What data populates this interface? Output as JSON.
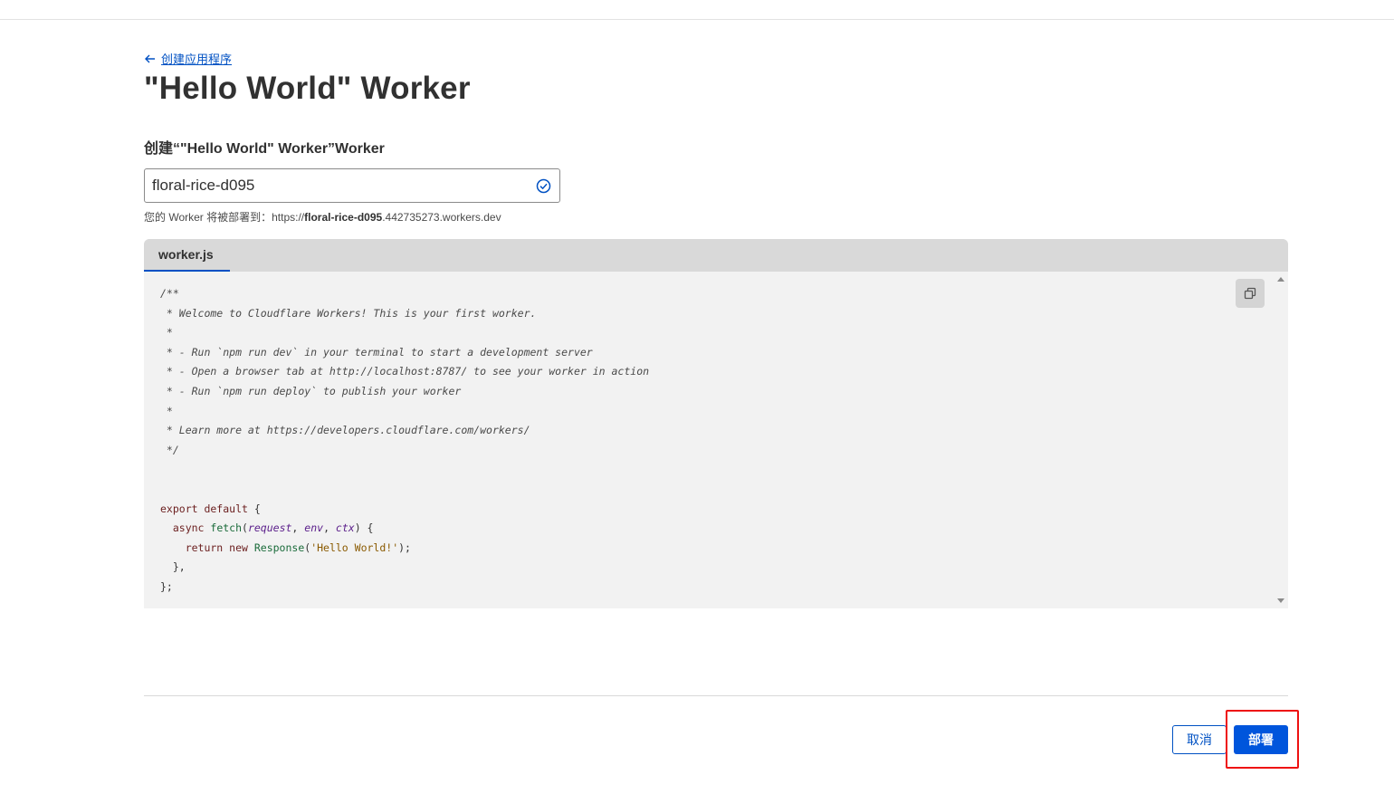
{
  "nav": {
    "back_label": "创建应用程序"
  },
  "page": {
    "title": "\"Hello World\" Worker",
    "section_title": "创建“\"Hello World\" Worker”Worker"
  },
  "worker_name": {
    "value": "floral-rice-d095",
    "hint_prefix": "您的 Worker 将被部署到：https://",
    "hint_name": "floral-rice-d095",
    "hint_suffix": ".442735273.workers.dev"
  },
  "editor": {
    "tab_label": "worker.js",
    "code": {
      "comment_lines": [
        "/**",
        " * Welcome to Cloudflare Workers! This is your first worker.",
        " *",
        " * - Run `npm run dev` in your terminal to start a development server",
        " * - Open a browser tab at http://localhost:8787/ to see your worker in action",
        " * - Run `npm run deploy` to publish your worker",
        " *",
        " * Learn more at https://developers.cloudflare.com/workers/",
        " */"
      ],
      "export_kw": "export default",
      "open_brace": " {",
      "async_kw": "  async ",
      "fetch_fn": "fetch",
      "paren_open": "(",
      "param_request": "request",
      "comma1": ", ",
      "param_env": "env",
      "comma2": ", ",
      "param_ctx": "ctx",
      "paren_close": ") {",
      "return_kw": "    return new ",
      "response_cls": "Response",
      "str_open": "(",
      "hello_str": "'Hello World!'",
      "str_close": ");",
      "close_fn": "  },",
      "close_obj": "};"
    }
  },
  "footer": {
    "cancel_label": "取消",
    "deploy_label": "部署"
  },
  "colors": {
    "accent": "#0051c3",
    "deploy_button": "#0055dc",
    "highlight": "#ee1111"
  },
  "icons": {
    "back": "arrow-left-icon",
    "valid": "check-circle-icon",
    "copy": "copy-icon"
  }
}
